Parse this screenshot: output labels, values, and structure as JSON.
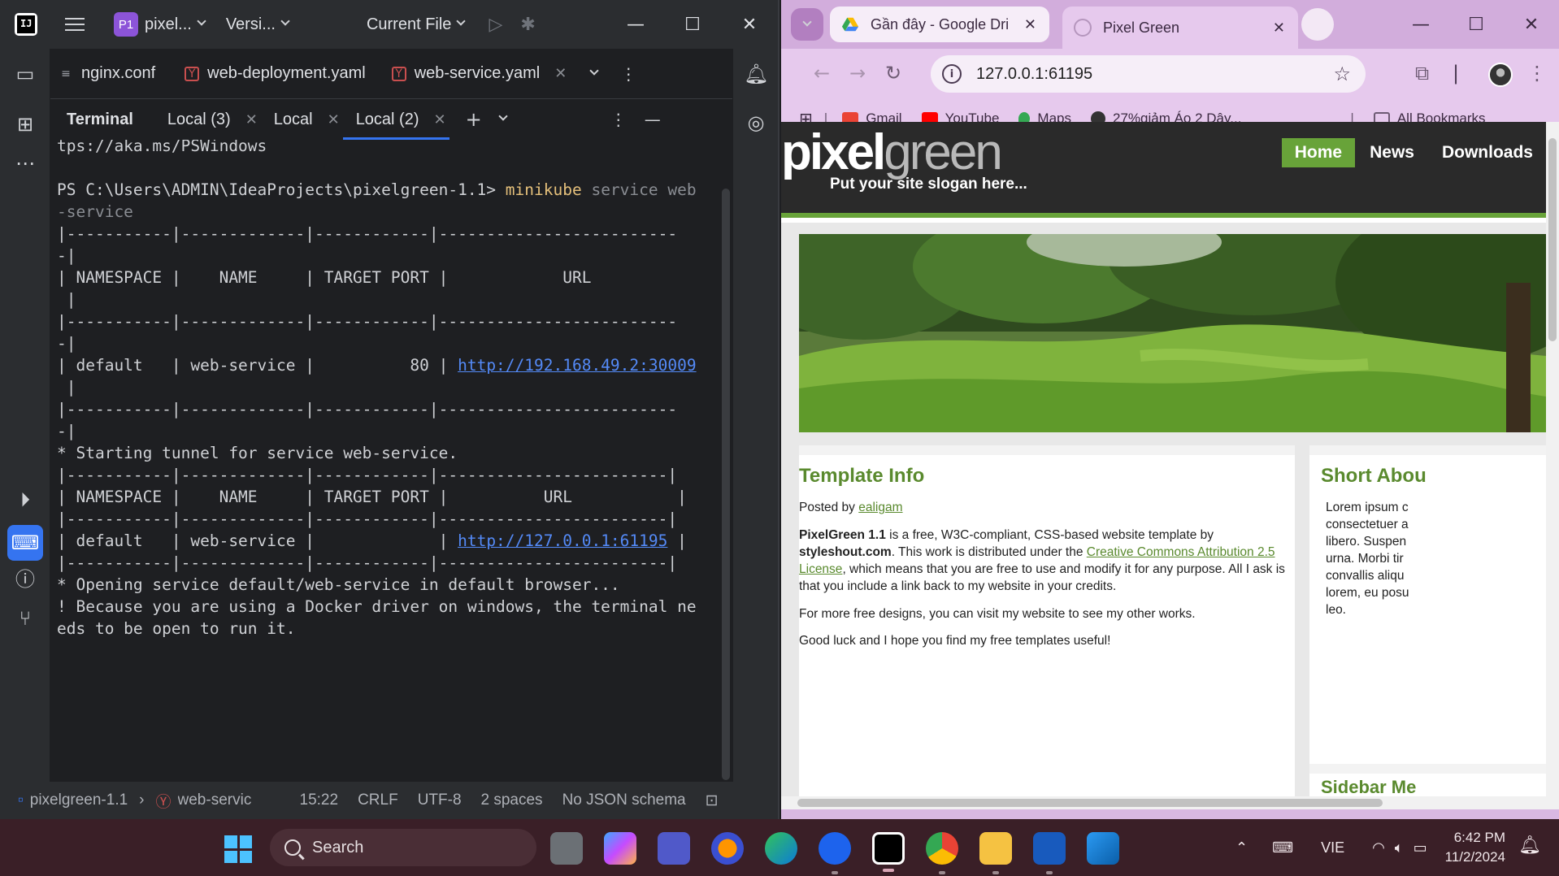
{
  "ide": {
    "project_badge": "P1",
    "project_name": "pixel...",
    "vcs": "Versi...",
    "run_config": "Current File",
    "editor_tabs": [
      {
        "label": "nginx.conf"
      },
      {
        "label": "web-deployment.yaml"
      },
      {
        "label": "web-service.yaml"
      }
    ],
    "terminal_title": "Terminal",
    "terminal_tabs": [
      {
        "label": "Local (3)"
      },
      {
        "label": "Local"
      },
      {
        "label": "Local (2)"
      }
    ],
    "terminal_lines": [
      "tps://aka.ms/PSWindows",
      "",
      "PS C:\\Users\\ADMIN\\IdeaProjects\\pixelgreen-1.1> ",
      "-service",
      "|-----------|-------------|------------|-------------------------",
      "-|",
      "| NAMESPACE |    NAME     | TARGET PORT |            URL",
      " |",
      "|-----------|-------------|------------|-------------------------",
      "-|",
      "| default   | web-service |          80 | ",
      " |",
      "|-----------|-------------|------------|-------------------------",
      "-|",
      "* Starting tunnel for service web-service.",
      "|-----------|-------------|------------|------------------------|",
      "| NAMESPACE |    NAME     | TARGET PORT |          URL           |",
      "|-----------|-------------|------------|------------------------|",
      "| default   | web-service |             | ",
      "|-----------|-------------|------------|------------------------|",
      "* Opening service default/web-service in default browser...",
      "! Because you are using a Docker driver on windows, the terminal ne",
      "eds to be open to run it."
    ],
    "cmd_keyword": "minikube",
    "cmd_args": "service web",
    "url_1": "http://192.168.49.2:30009",
    "url_2": "http://127.0.0.1:61195",
    "url_2_tail": " |",
    "status": {
      "project": "pixelgreen-1.1",
      "file": "web-servic",
      "position": "15:22",
      "line_sep": "CRLF",
      "encoding": "UTF-8",
      "indent": "2 spaces",
      "schema": "No JSON schema"
    }
  },
  "browser": {
    "tab_inactive": "Gần đây - Google Driv",
    "tab_active": "Pixel Green",
    "url": "127.0.0.1:61195",
    "bookmarks": [
      {
        "label": "Gmail",
        "color": "#ea4335"
      },
      {
        "label": "YouTube",
        "color": "#ff0000"
      },
      {
        "label": "Maps",
        "color": "#34a853"
      },
      {
        "label": "27%giảm Áo 2 Dây...",
        "color": "#333333"
      }
    ],
    "all_bookmarks": "All Bookmarks",
    "site": {
      "logo_a": "pixel",
      "logo_b": "green",
      "slogan": "Put your site slogan here...",
      "nav": [
        "Home",
        "News",
        "Downloads"
      ],
      "main_title": "Template Info",
      "posted_by_prefix": "Posted by ",
      "author": "ealigam",
      "p1_a": "PixelGreen 1.1",
      "p1_b": " is a free, W3C-compliant, CSS-based website template by ",
      "p1_c": "styleshout.com",
      "p1_d": ". This work is distributed under the ",
      "p1_link": "Creative Commons Attribution 2.5 License",
      "p1_e": ", which means that you are free to use and modify it for any purpose. All I ask is that you include a link back to my website in your credits.",
      "p2": "For more free designs, you can visit my website to see my other works.",
      "p3": "Good luck and I hope you find my free templates useful!",
      "side_title": "Short Abou",
      "side_text": [
        "Lorem ipsum c",
        "consectetuer a",
        "libero. Suspen",
        "urna. Morbi tir",
        "convallis aliqu",
        "lorem, eu posu",
        "leo."
      ],
      "side_title_2": "Sidebar Me"
    }
  },
  "taskbar": {
    "search_label": "Search",
    "language": "VIE",
    "time": "6:42 PM",
    "date": "11/2/2024"
  },
  "colors": {
    "ide_bg": "#1e1f22",
    "accent_blue": "#3574f0",
    "site_green": "#68a339",
    "browser_chrome": "#e6c9ed"
  }
}
